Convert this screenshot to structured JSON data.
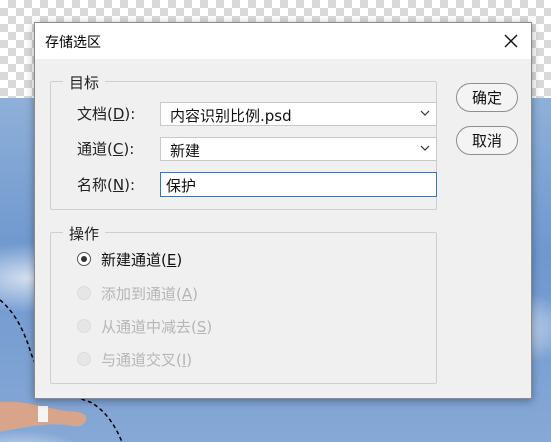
{
  "dialog": {
    "title": "存储选区",
    "close_icon": "close-icon"
  },
  "target_group": {
    "legend": "目标",
    "document": {
      "label": "文档(",
      "key": "D",
      "suffix": "):",
      "value": "内容识别比例.psd"
    },
    "channel": {
      "label": "通道(",
      "key": "C",
      "suffix": "):",
      "value": "新建"
    },
    "name": {
      "label": "名称(",
      "key": "N",
      "suffix": "):",
      "value": "保护"
    }
  },
  "operation_group": {
    "legend": "操作",
    "options": [
      {
        "label": "新建通道(",
        "key": "E",
        "suffix": ")",
        "selected": true,
        "enabled": true
      },
      {
        "label": "添加到通道(",
        "key": "A",
        "suffix": ")",
        "selected": false,
        "enabled": false
      },
      {
        "label": "从通道中减去(",
        "key": "S",
        "suffix": ")",
        "selected": false,
        "enabled": false
      },
      {
        "label": "与通道交叉(",
        "key": "I",
        "suffix": ")",
        "selected": false,
        "enabled": false
      }
    ]
  },
  "buttons": {
    "ok": "确定",
    "cancel": "取消"
  },
  "colors": {
    "focus_border": "#2c79c7",
    "dialog_bg": "#f0f0f0"
  }
}
